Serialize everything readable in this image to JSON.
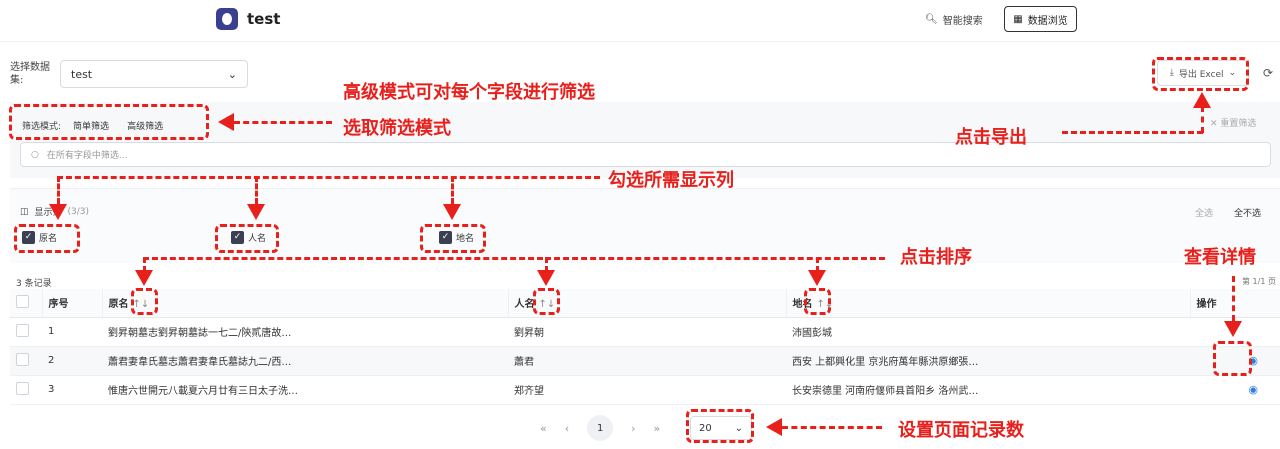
{
  "app": {
    "title": "test"
  },
  "nav": {
    "search": "智能搜索",
    "browse": "数据浏览"
  },
  "dataset": {
    "label": "选择数据集:",
    "value": "test"
  },
  "export": {
    "label": "导出 Excel"
  },
  "filter": {
    "mode_label": "筛选模式:",
    "simple": "简单筛选",
    "advanced": "高级筛选",
    "reset": "重置筛选",
    "placeholder": "在所有字段中筛选..."
  },
  "columns": {
    "title": "显示列",
    "count": "(3/3)",
    "select_all": "全选",
    "select_none": "全不选",
    "options": [
      "原名",
      "人名",
      "地名"
    ]
  },
  "table": {
    "record_count": "3 条记录",
    "page_info": "第 1/1 页",
    "headers": {
      "index": "序号",
      "name": "原名",
      "person": "人名",
      "place": "地名",
      "actions": "操作"
    },
    "rows": [
      {
        "index": "1",
        "name": "劉昇朝墓志劉昇朝墓誌一七二/陝貳唐故…",
        "person": "劉昇朝",
        "place": "沛國彭城"
      },
      {
        "index": "2",
        "name": "蕭君妻韋氏墓志蕭君妻韋氏墓誌九二/西…",
        "person": "蕭君",
        "place": "西安 上都興化里 京兆府萬年縣洪原鄉張…"
      },
      {
        "index": "3",
        "name": "惟唐六世開元八載夏六月廿有三日太子洗…",
        "person": "郑齐望",
        "place": "长安崇德里 河南府偃师县首阳乡 洛州武…"
      }
    ]
  },
  "pager": {
    "current": "1",
    "page_size": "20"
  },
  "annotations": {
    "advanced_mode": "高级模式可对每个字段进行筛选",
    "pick_mode": "选取筛选模式",
    "export": "点击导出",
    "pick_columns": "勾选所需显示列",
    "sort": "点击排序",
    "details": "查看详情",
    "page_size": "设置页面记录数"
  },
  "colors": {
    "annotation": "#e8201c",
    "brand": "#3b3f8f",
    "link": "#2f7fd9"
  }
}
